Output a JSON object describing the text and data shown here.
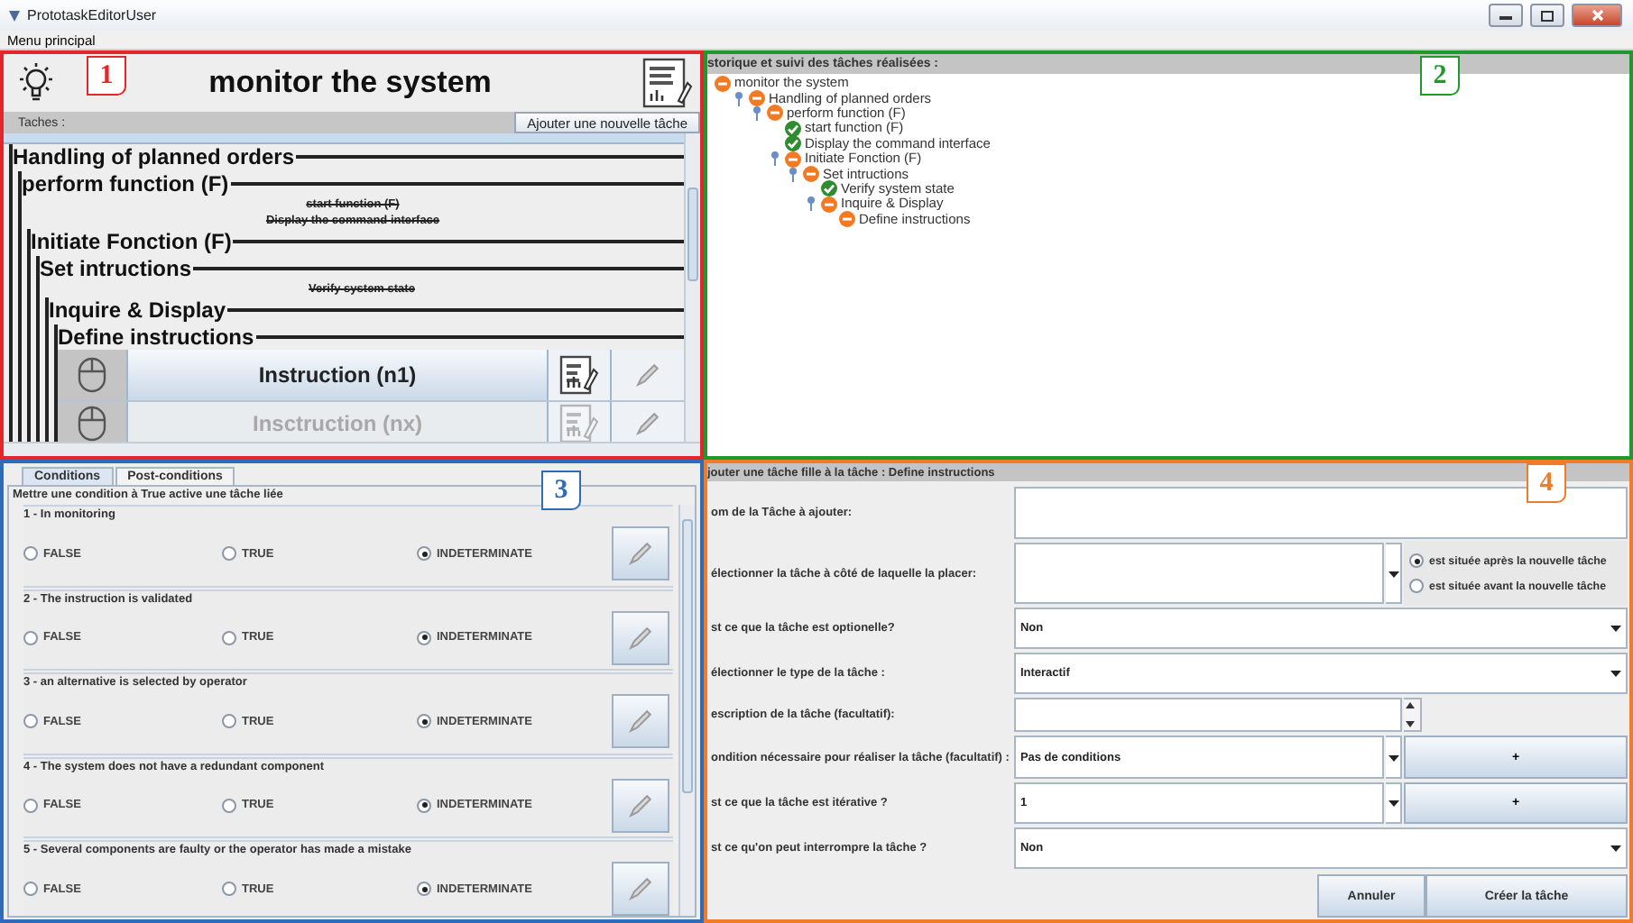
{
  "window": {
    "title": "PrototaskEditorUser",
    "menu": [
      "Menu principal"
    ]
  },
  "task_panel": {
    "annotation": {
      "label": "1",
      "color": "#e3262b"
    },
    "title": "monitor the system",
    "tasks_label": "Taches :",
    "add_button": "Ajouter une nouvelle tâche",
    "tasks": [
      {
        "label": "Handling of planned orders",
        "done": false,
        "children": [
          {
            "label": "perform function (F)",
            "done": false,
            "children": [
              {
                "label": "start function (F)",
                "done": true
              },
              {
                "label": "Display the command interface",
                "done": true
              },
              {
                "label": "Initiate Fonction (F)",
                "done": false,
                "children": [
                  {
                    "label": "Set intructions",
                    "done": false,
                    "children": [
                      {
                        "label": "Verify system state",
                        "done": true
                      },
                      {
                        "label": "Inquire & Display",
                        "done": false,
                        "children": [
                          {
                            "label": "Define instructions",
                            "done": false,
                            "instructions": [
                              {
                                "label": "Instruction (n1)",
                                "disabled": false
                              },
                              {
                                "label": "Insctruction (nx)",
                                "disabled": true
                              }
                            ]
                          }
                        ]
                      }
                    ]
                  }
                ]
              }
            ]
          }
        ]
      }
    ]
  },
  "history_panel": {
    "annotation": {
      "label": "2",
      "color": "#1e9a2c"
    },
    "heading": "storique et suivi des tâches réalisées :",
    "tree": [
      {
        "label": "monitor the system",
        "done": false,
        "children": [
          {
            "label": "Handling of planned orders",
            "done": false,
            "children": [
              {
                "label": "perform function (F)",
                "done": false,
                "children": [
                  {
                    "label": "start function (F)",
                    "done": true
                  },
                  {
                    "label": "Display the command interface",
                    "done": true
                  },
                  {
                    "label": "Initiate Fonction (F)",
                    "done": false,
                    "children": [
                      {
                        "label": "Set intructions",
                        "done": false,
                        "children": [
                          {
                            "label": "Verify system state",
                            "done": true
                          },
                          {
                            "label": "Inquire & Display",
                            "done": false,
                            "children": [
                              {
                                "label": "Define instructions",
                                "done": false
                              }
                            ]
                          }
                        ]
                      }
                    ]
                  }
                ]
              }
            ]
          }
        ]
      }
    ]
  },
  "conditions_panel": {
    "annotation": {
      "label": "3",
      "color": "#2e6bb8"
    },
    "tabs": [
      {
        "label": "Conditions",
        "selected": true
      },
      {
        "label": "Post-conditions",
        "selected": false
      }
    ],
    "note": "Mettre une condition à True active une tâche liée",
    "conditions": [
      {
        "title": "1 - In monitoring",
        "options": [
          {
            "label": "FALSE",
            "selected": false
          },
          {
            "label": "TRUE",
            "selected": false
          },
          {
            "label": "INDETERMINATE",
            "selected": true
          }
        ]
      },
      {
        "title": "2 - The instruction is validated",
        "options": [
          {
            "label": "FALSE",
            "selected": false
          },
          {
            "label": "TRUE",
            "selected": false
          },
          {
            "label": "INDETERMINATE",
            "selected": true
          }
        ]
      },
      {
        "title": "3 - an alternative is selected by operator",
        "options": [
          {
            "label": "FALSE",
            "selected": false
          },
          {
            "label": "TRUE",
            "selected": false
          },
          {
            "label": "INDETERMINATE",
            "selected": true
          }
        ]
      },
      {
        "title": "4 - The system does not have a redundant component",
        "options": [
          {
            "label": "FALSE",
            "selected": false
          },
          {
            "label": "TRUE",
            "selected": false
          },
          {
            "label": "INDETERMINATE",
            "selected": true
          }
        ]
      },
      {
        "title": "5 - Several components are faulty or the operator has made a mistake",
        "options": [
          {
            "label": "FALSE",
            "selected": false
          },
          {
            "label": "TRUE",
            "selected": false
          },
          {
            "label": "INDETERMINATE",
            "selected": true
          }
        ]
      }
    ]
  },
  "form_panel": {
    "annotation": {
      "label": "4",
      "color": "#f07b2a"
    },
    "heading": "jouter une tâche fille à la tâche : Define instructions",
    "rows": [
      {
        "kind": "text",
        "label": "om de la Tâche à ajouter:"
      },
      {
        "kind": "combo_radio",
        "label": "électionner la tâche à côté de laquelle la placer:",
        "options": [
          {
            "label": "est située après la nouvelle tâche",
            "selected": true
          },
          {
            "label": "est située avant la nouvelle tâche",
            "selected": false
          }
        ]
      },
      {
        "kind": "combo",
        "label": "st ce que la tâche est optionelle?",
        "value": "Non"
      },
      {
        "kind": "combo",
        "label": "électionner le type de la tâche :",
        "value": "Interactif"
      },
      {
        "kind": "textarea",
        "label": "escription de la tâche (facultatif):"
      },
      {
        "kind": "combo_button",
        "label": "ondition nécessaire pour réaliser la tâche (facultatif) :",
        "value": "Pas de conditions",
        "button": "+"
      },
      {
        "kind": "combo_button",
        "label": "st ce que la tâche est itérative ?",
        "value": "1",
        "button": "+"
      },
      {
        "kind": "combo",
        "label": "st ce qu'on peut interrompre la tâche ?",
        "value": "Non"
      }
    ],
    "buttons": [
      "Annuler",
      "Créer la tâche"
    ]
  }
}
